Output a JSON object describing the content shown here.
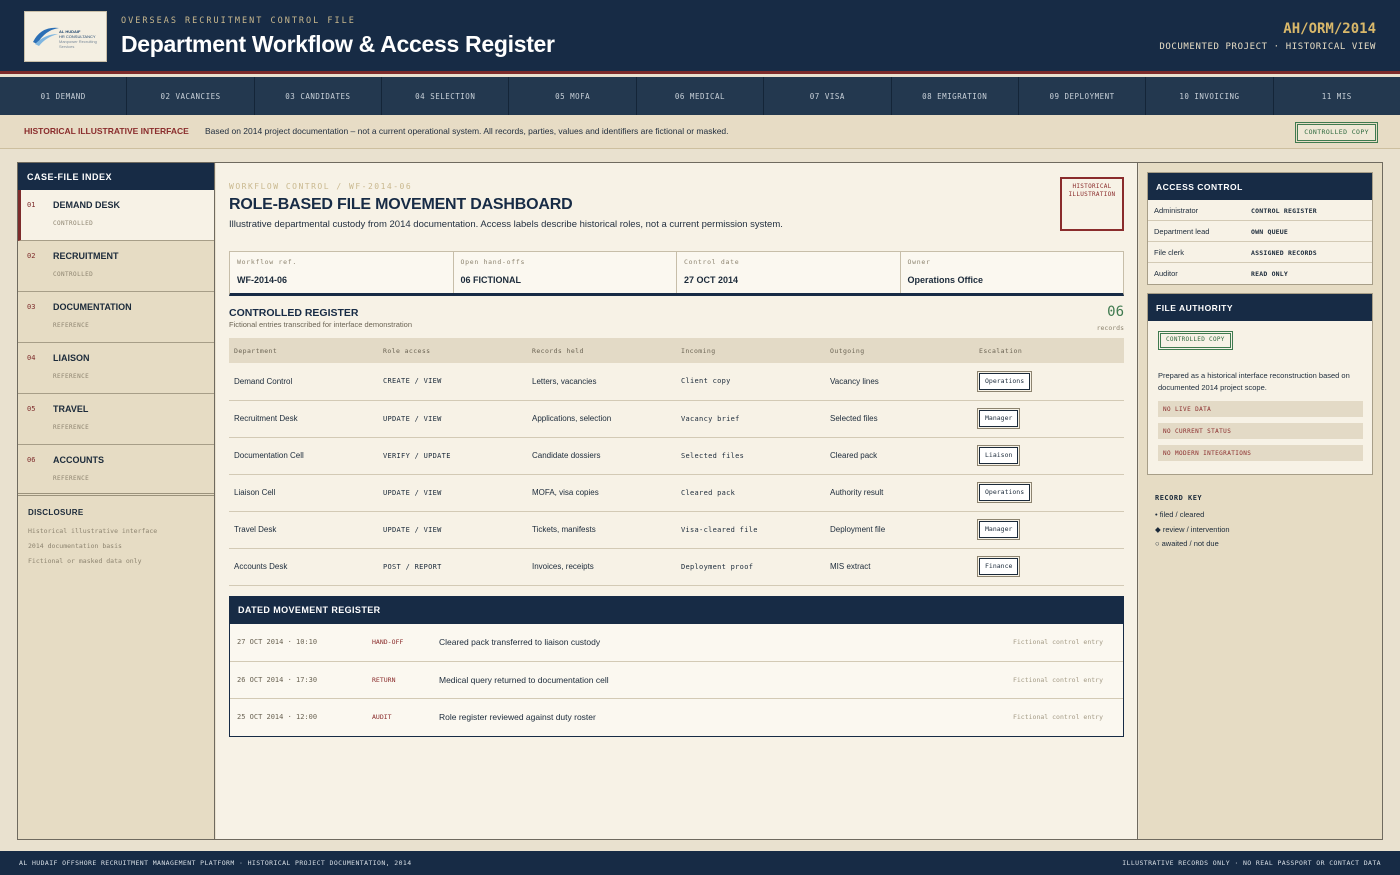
{
  "header": {
    "logo_text": [
      "AL HUDAIF",
      "HR CONSULTANCY",
      "Manpower Recruiting Services"
    ],
    "kicker": "OVERSEAS RECRUITMENT CONTROL FILE",
    "title": "Department Workflow & Access Register",
    "code": "AH/ORM/2014",
    "subtitle": "DOCUMENTED PROJECT · HISTORICAL VIEW"
  },
  "stages": [
    "01 DEMAND",
    "02 VACANCIES",
    "03 CANDIDATES",
    "04 SELECTION",
    "05 MOFA",
    "06 MEDICAL",
    "07 VISA",
    "08 EMIGRATION",
    "09 DEPLOYMENT",
    "10 INVOICING",
    "11 MIS"
  ],
  "notice": {
    "label": "HISTORICAL ILLUSTRATIVE INTERFACE",
    "text": "Based on 2014 project documentation – not a current operational system. All records, parties, values and identifiers are fictional or masked.",
    "badge": "CONTROLLED COPY"
  },
  "index": {
    "title": "CASE-FILE INDEX",
    "items": [
      {
        "num": "01",
        "name": "DEMAND DESK",
        "status": "CONTROLLED"
      },
      {
        "num": "02",
        "name": "RECRUITMENT",
        "status": "CONTROLLED"
      },
      {
        "num": "03",
        "name": "DOCUMENTATION",
        "status": "REFERENCE"
      },
      {
        "num": "04",
        "name": "LIAISON",
        "status": "REFERENCE"
      },
      {
        "num": "05",
        "name": "TRAVEL",
        "status": "REFERENCE"
      },
      {
        "num": "06",
        "name": "ACCOUNTS",
        "status": "REFERENCE"
      }
    ],
    "disclosure": {
      "title": "DISCLOSURE",
      "lines": [
        "Historical illustrative interface",
        "2014 documentation basis",
        "Fictional or masked data only"
      ]
    }
  },
  "main": {
    "kicker": "WORKFLOW CONTROL / WF-2014-06",
    "title": "ROLE-BASED FILE MOVEMENT DASHBOARD",
    "description": "Illustrative departmental custody from 2014 documentation. Access labels describe historical roles, not a current permission system.",
    "stamp_line1": "HISTORICAL",
    "stamp_line2": "ILLUSTRATION",
    "meta": [
      {
        "label": "Workflow ref.",
        "value": "WF-2014-06"
      },
      {
        "label": "Open hand-offs",
        "value": "06 FICTIONAL"
      },
      {
        "label": "Control date",
        "value": "27 OCT 2014"
      },
      {
        "label": "Owner",
        "value": "Operations Office"
      }
    ],
    "register": {
      "title": "CONTROLLED REGISTER",
      "subtitle": "Fictional entries transcribed for interface demonstration",
      "count": "06",
      "count_label": "records",
      "columns": [
        "Department",
        "Role access",
        "Records held",
        "Incoming",
        "Outgoing",
        "Escalation"
      ],
      "rows": [
        {
          "dept": "Demand Control",
          "access": "CREATE / VIEW",
          "records": "Letters, vacancies",
          "incoming": "Client copy",
          "outgoing": "Vacancy lines",
          "escalation": "Operations"
        },
        {
          "dept": "Recruitment Desk",
          "access": "UPDATE / VIEW",
          "records": "Applications, selection",
          "incoming": "Vacancy brief",
          "outgoing": "Selected files",
          "escalation": "Manager"
        },
        {
          "dept": "Documentation Cell",
          "access": "VERIFY / UPDATE",
          "records": "Candidate dossiers",
          "incoming": "Selected files",
          "outgoing": "Cleared pack",
          "escalation": "Liaison"
        },
        {
          "dept": "Liaison Cell",
          "access": "UPDATE / VIEW",
          "records": "MOFA, visa copies",
          "incoming": "Cleared pack",
          "outgoing": "Authority result",
          "escalation": "Operations"
        },
        {
          "dept": "Travel Desk",
          "access": "UPDATE / VIEW",
          "records": "Tickets, manifests",
          "incoming": "Visa-cleared file",
          "outgoing": "Deployment file",
          "escalation": "Manager"
        },
        {
          "dept": "Accounts Desk",
          "access": "POST / REPORT",
          "records": "Invoices, receipts",
          "incoming": "Deployment proof",
          "outgoing": "MIS extract",
          "escalation": "Finance"
        }
      ]
    },
    "movement": {
      "title": "DATED MOVEMENT REGISTER",
      "rows": [
        {
          "time": "27 OCT 2014 · 10:10",
          "kind": "HAND-OFF",
          "desc": "Cleared pack transferred to liaison custody",
          "note": "Fictional control entry"
        },
        {
          "time": "26 OCT 2014 · 17:30",
          "kind": "RETURN",
          "desc": "Medical query returned to documentation cell",
          "note": "Fictional control entry"
        },
        {
          "time": "25 OCT 2014 · 12:00",
          "kind": "AUDIT",
          "desc": "Role register reviewed against duty roster",
          "note": "Fictional control entry"
        }
      ]
    }
  },
  "access_control": {
    "title": "ACCESS CONTROL",
    "rows": [
      {
        "role": "Administrator",
        "perm": "CONTROL REGISTER"
      },
      {
        "role": "Department lead",
        "perm": "OWN QUEUE"
      },
      {
        "role": "File clerk",
        "perm": "ASSIGNED RECORDS"
      },
      {
        "role": "Auditor",
        "perm": "READ ONLY"
      }
    ]
  },
  "file_authority": {
    "title": "FILE AUTHORITY",
    "badge": "CONTROLLED COPY",
    "text": "Prepared as a historical interface reconstruction based on documented 2014 project scope.",
    "flags": [
      "NO LIVE DATA",
      "NO CURRENT STATUS",
      "NO MODERN INTEGRATIONS"
    ]
  },
  "record_key": {
    "title": "RECORD KEY",
    "items": [
      "• filed / cleared",
      "◆ review / intervention",
      "○ awaited / not due"
    ]
  },
  "footer": {
    "left": "AL HUDAIF OFFSHORE RECRUITMENT MANAGEMENT PLATFORM · HISTORICAL PROJECT DOCUMENTATION, 2014",
    "right": "ILLUSTRATIVE RECORDS ONLY · NO REAL PASSPORT OR CONTACT DATA"
  },
  "colors": {
    "navy": "#172b45",
    "maroon": "#7d2b2b",
    "green": "#3f7a4f",
    "paper": "#f7f2e6",
    "parchment": "#e6dcc4"
  }
}
